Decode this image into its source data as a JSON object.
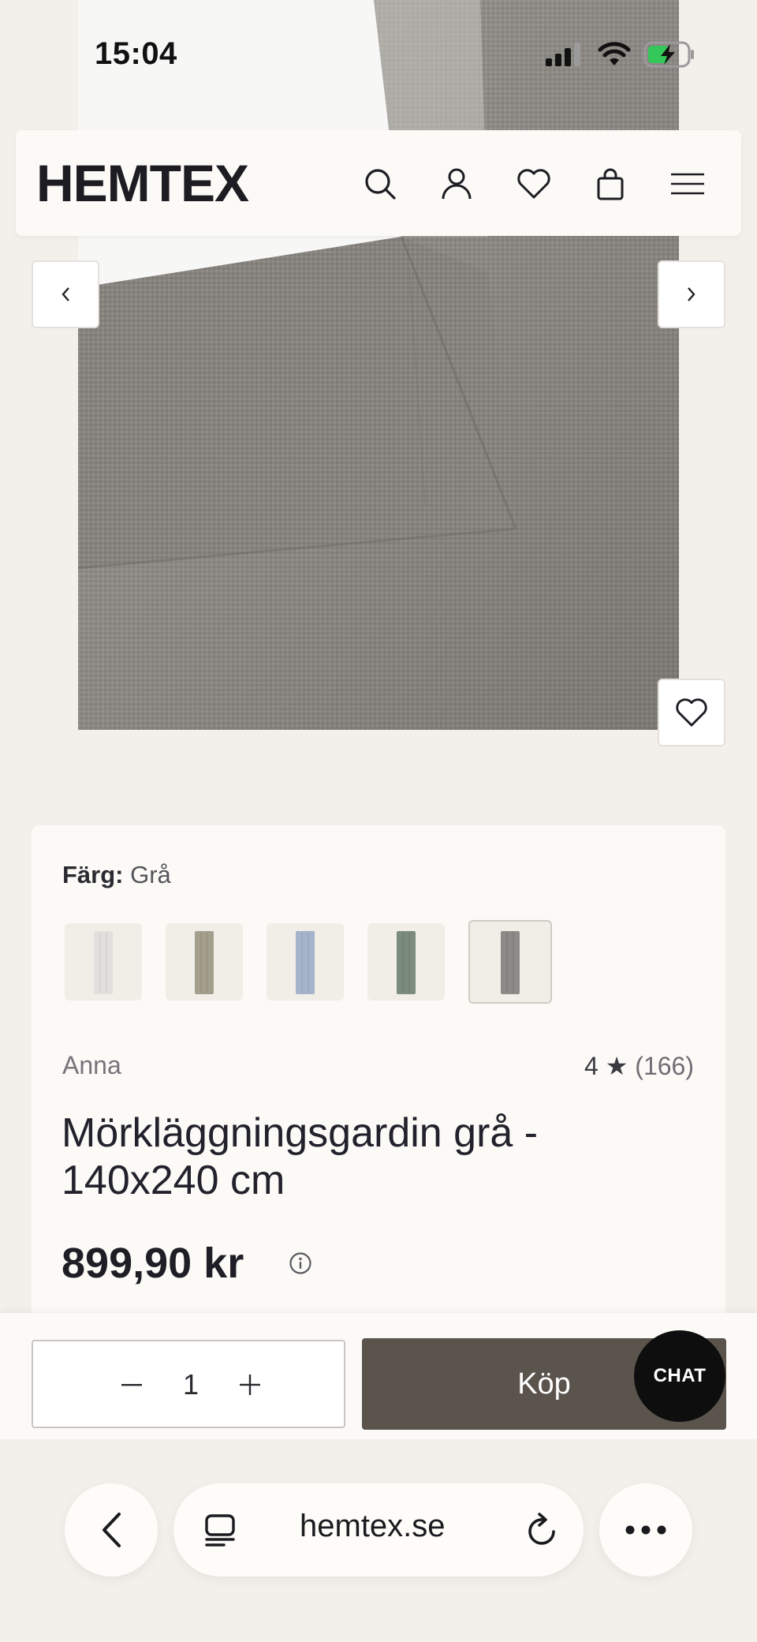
{
  "status_bar": {
    "time": "15:04"
  },
  "header": {
    "logo": "HEMTEX",
    "icons": [
      "search-icon",
      "account-icon",
      "heart-icon",
      "bag-icon",
      "menu-icon"
    ]
  },
  "gallery": {
    "prev_icon": "chevron-left-icon",
    "next_icon": "chevron-right-icon",
    "favorite_icon": "heart-icon"
  },
  "product": {
    "color_label": "Färg:",
    "color_value": "Grå",
    "swatch_colors": [
      "#e2e0dc",
      "#a49f8c",
      "#a5b3cb",
      "#7b8c7d",
      "#8d8b87"
    ],
    "selected_swatch": 4,
    "brand": "Anna",
    "rating_value": "4 ★",
    "rating_count": "(166)",
    "title": "Mörkläggningsgardin grå - 140x240 cm",
    "price": "899,90 kr"
  },
  "buy_bar": {
    "quantity": "1",
    "buy_label": "Köp",
    "chat_label": "CHAT"
  },
  "browser": {
    "url": "hemtex.se"
  },
  "colors": {
    "background": "#f3f0eb",
    "card": "#fbfaf6",
    "buy_button": "#5b544d",
    "chat_button": "#0e0e0e",
    "fabric": "#8a8782"
  }
}
